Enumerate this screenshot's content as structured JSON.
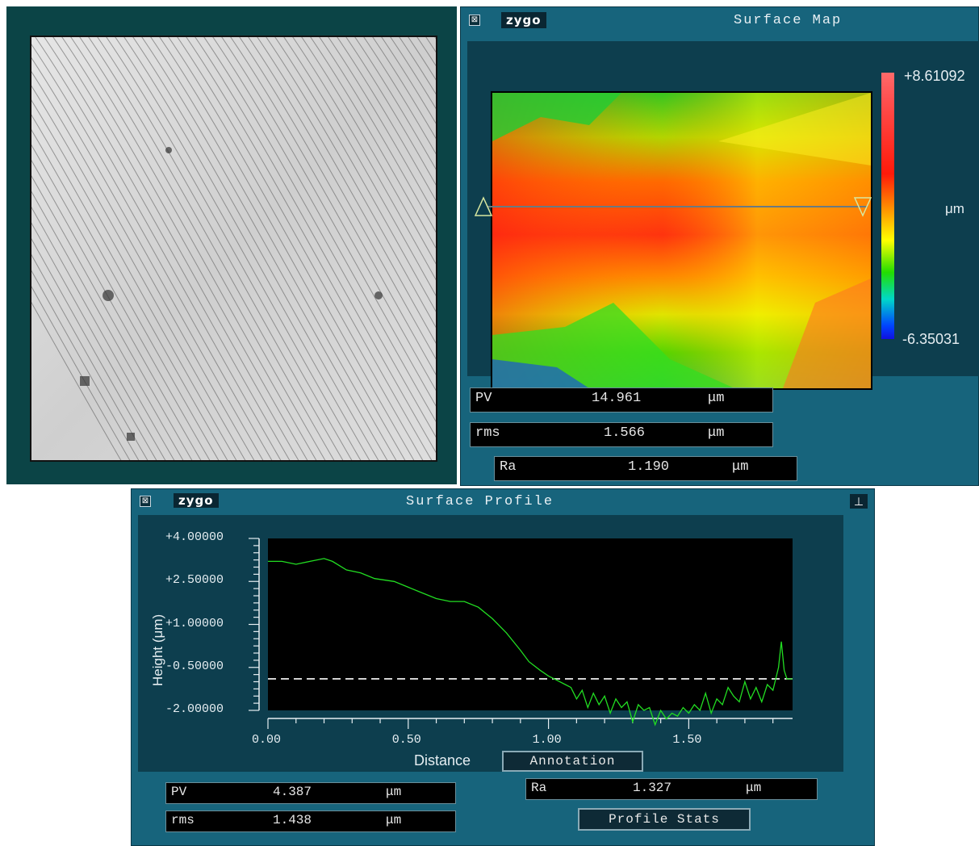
{
  "colors": {
    "panel_bg": "#0b4446",
    "window_bg": "#17647c",
    "field_bg": "#000000",
    "trace": "#22dd22"
  },
  "icons": {
    "close": "close-box-icon",
    "zoom_tool": "zoom-tool-icon"
  },
  "surface_map": {
    "logo": "zygo",
    "title": "Surface Map",
    "colorbar_max": "+8.61092",
    "colorbar_min": "-6.35031",
    "colorbar_unit": "μm",
    "stats": [
      {
        "label": "PV",
        "value": "14.961",
        "unit": "μm"
      },
      {
        "label": "rms",
        "value": "1.566",
        "unit": "μm"
      },
      {
        "label": "Ra",
        "value": "1.190",
        "unit": "μm"
      }
    ]
  },
  "surface_profile": {
    "logo": "zygo",
    "title": "Surface Profile",
    "ylabel": "Height (μm)",
    "xlabel": "Distance",
    "annotation_label": "Annotation",
    "profile_stats_label": "Profile Stats",
    "stats": [
      {
        "label": "PV",
        "value": "4.387",
        "unit": "μm"
      },
      {
        "label": "rms",
        "value": "1.438",
        "unit": "μm"
      },
      {
        "label": "Ra",
        "value": "1.327",
        "unit": "μm"
      }
    ]
  },
  "chart_data": {
    "type": "line",
    "title": "",
    "xlabel": "Distance",
    "ylabel": "Height (μm)",
    "y_tick_labels": [
      "+4.00000",
      "+2.50000",
      "+1.00000",
      "-0.50000",
      "-2.00000"
    ],
    "x_tick_labels": [
      "0.00",
      "0.50",
      "1.00",
      "1.50"
    ],
    "xlim": [
      0,
      1.87
    ],
    "ylim": [
      -2.0,
      4.0
    ],
    "grid": false,
    "reference_line_y": -0.9,
    "series": [
      {
        "name": "",
        "x": [
          0.0,
          0.05,
          0.1,
          0.15,
          0.2,
          0.23,
          0.28,
          0.33,
          0.38,
          0.45,
          0.5,
          0.55,
          0.6,
          0.65,
          0.7,
          0.75,
          0.8,
          0.85,
          0.9,
          0.93,
          0.97,
          1.0,
          1.03,
          1.06,
          1.08,
          1.1,
          1.12,
          1.14,
          1.16,
          1.18,
          1.2,
          1.22,
          1.24,
          1.26,
          1.28,
          1.3,
          1.32,
          1.34,
          1.36,
          1.38,
          1.4,
          1.42,
          1.44,
          1.46,
          1.48,
          1.5,
          1.52,
          1.54,
          1.56,
          1.58,
          1.6,
          1.62,
          1.64,
          1.66,
          1.68,
          1.7,
          1.72,
          1.74,
          1.76,
          1.78,
          1.8,
          1.82,
          1.83,
          1.84,
          1.85,
          1.87
        ],
        "y": [
          3.2,
          3.2,
          3.1,
          3.2,
          3.3,
          3.2,
          2.9,
          2.8,
          2.6,
          2.5,
          2.3,
          2.1,
          1.9,
          1.8,
          1.8,
          1.6,
          1.2,
          0.7,
          0.1,
          -0.3,
          -0.6,
          -0.8,
          -0.95,
          -1.1,
          -1.2,
          -1.6,
          -1.3,
          -1.9,
          -1.4,
          -1.8,
          -1.5,
          -2.1,
          -1.6,
          -1.9,
          -1.7,
          -2.4,
          -1.8,
          -2.0,
          -1.9,
          -2.5,
          -2.0,
          -2.3,
          -2.1,
          -2.2,
          -1.9,
          -2.1,
          -1.8,
          -2.0,
          -1.4,
          -2.1,
          -1.6,
          -1.8,
          -1.2,
          -1.5,
          -1.7,
          -1.0,
          -1.6,
          -1.2,
          -1.7,
          -1.1,
          -1.3,
          -0.5,
          0.4,
          -0.6,
          -0.9,
          -0.9
        ]
      }
    ]
  }
}
